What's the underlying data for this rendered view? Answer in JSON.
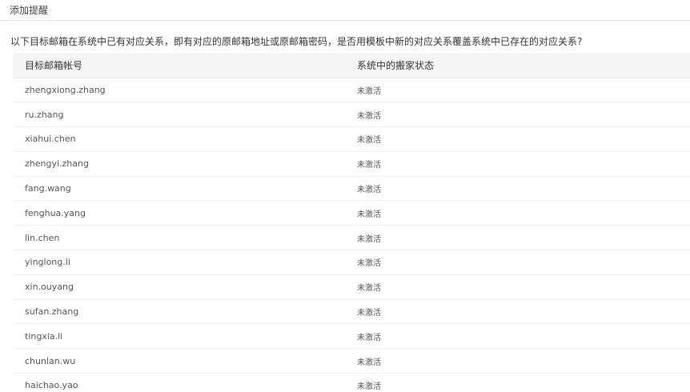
{
  "dialog": {
    "title": "添加提醒",
    "message": "以下目标邮箱在系统中已有对应关系，即有对应的原邮箱地址或原邮箱密码，是否用模板中新的对应关系覆盖系统中已存在的对应关系?"
  },
  "table": {
    "columns": [
      "目标邮箱帐号",
      "系统中的搬家状态"
    ],
    "rows": [
      {
        "account": "zhengxiong.zhang",
        "status": "未激活"
      },
      {
        "account": "ru.zhang",
        "status": "未激活"
      },
      {
        "account": "xiahui.chen",
        "status": "未激活"
      },
      {
        "account": "zhengyi.zhang",
        "status": "未激活"
      },
      {
        "account": "fang.wang",
        "status": "未激活"
      },
      {
        "account": "fenghua.yang",
        "status": "未激活"
      },
      {
        "account": "lin.chen",
        "status": "未激活"
      },
      {
        "account": "yinglong.li",
        "status": "未激活"
      },
      {
        "account": "xin.ouyang",
        "status": "未激活"
      },
      {
        "account": "sufan.zhang",
        "status": "未激活"
      },
      {
        "account": "tingxia.li",
        "status": "未激活"
      },
      {
        "account": "chunlan.wu",
        "status": "未激活"
      },
      {
        "account": "haichao.yao",
        "status": "未激活"
      }
    ]
  }
}
